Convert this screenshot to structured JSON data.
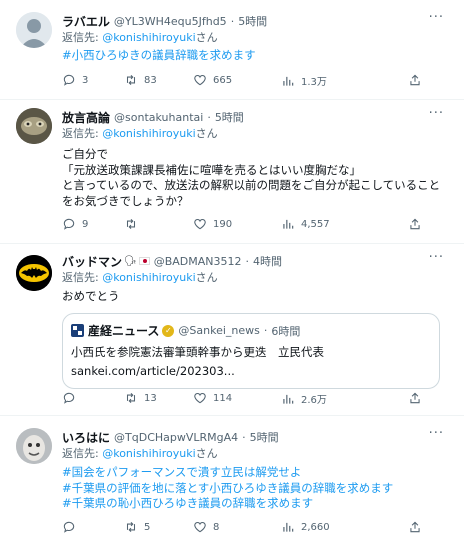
{
  "reply_prefix": "返信先:",
  "reply_mention": "@konishihiroyuki",
  "reply_suffix": "さん",
  "tweets": [
    {
      "name": "ラバエル",
      "handle": "@YL3WH4equ5Jfhd5",
      "time": "5時間",
      "lines": [
        "#小西ひろゆきの議員辞職を求めます"
      ],
      "replies": "3",
      "retweets": "83",
      "likes": "665",
      "views": "1.3万"
    },
    {
      "name": "放言高論",
      "handle": "@sontakuhantai",
      "time": "5時間",
      "lines": [
        "ご自分で",
        "「元放送政策課課長補佐に喧嘩を売るとはいい度胸だな」",
        "と言っているので、放送法の解釈以前の問題をご自分が起こしていること",
        "をお気づきでしょうか？"
      ],
      "replies": "9",
      "retweets": "",
      "likes": "190",
      "views": "4,557"
    },
    {
      "name": "バッドマン",
      "handle": "@BADMAN3512",
      "time": "4時間",
      "lines": [
        "おめでとう"
      ],
      "quote": {
        "source_name": "産経ニュース",
        "source_handle": "@Sankei_news",
        "source_time": "6時間",
        "text": "小西氏を参院憲法審筆頭幹事から更迭　立民代表",
        "url": "sankei.com/article/202303..."
      },
      "replies": "",
      "retweets": "13",
      "likes": "114",
      "views": "2.6万"
    },
    {
      "name": "いろはに",
      "handle": "@TqDCHapwVLRMgA4",
      "time": "5時間",
      "lines": [
        "#国会をパフォーマンスで潰す立民は解党せよ",
        "#千葉県の評価を地に落とす小西ひろゆき議員の辞職を求めます",
        "#千葉県の恥小西ひろゆき議員の辞職を求めます"
      ],
      "replies": "",
      "retweets": "5",
      "likes": "8",
      "views": "2,660"
    }
  ],
  "colors": {
    "link": "#1d9bf0",
    "muted": "#536471",
    "border": "#eff3f4"
  },
  "icons": [
    "more-icon",
    "reply-icon",
    "retweet-icon",
    "like-icon",
    "views-icon",
    "share-icon",
    "verified-icon"
  ]
}
